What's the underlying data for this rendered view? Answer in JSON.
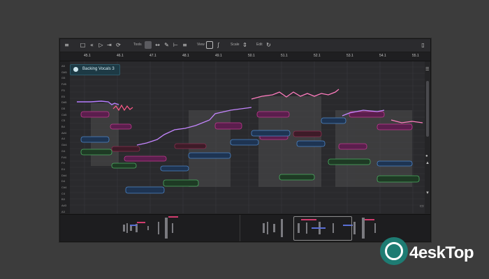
{
  "toolbar": {
    "menu_icon": "≡",
    "tool_label": "Tools",
    "view_label": "View",
    "scale_label": "Scale",
    "edit_label": "Edit",
    "sidebar_icon": "▯"
  },
  "ruler": {
    "ticks": [
      "45.1",
      "46.1",
      "47.1",
      "48.1",
      "49.1",
      "50.1",
      "51.1",
      "52.1",
      "53.1",
      "54.1",
      "55.1"
    ]
  },
  "keys": [
    "A5",
    "G#5",
    "G5",
    "F#5",
    "F5",
    "E5",
    "D#5",
    "D5",
    "C#5",
    "C5",
    "B4",
    "A#4",
    "A4",
    "G#4",
    "G4",
    "F#4",
    "F4",
    "E4",
    "D#4",
    "D4",
    "C#4",
    "C4",
    "B3",
    "A#3",
    "A3"
  ],
  "track": {
    "name": "Backing Vocals 3"
  },
  "colors": {
    "accent": "#3b8aa3",
    "brand": "#1e7c73"
  },
  "watermark": {
    "text": "4eskTop"
  }
}
